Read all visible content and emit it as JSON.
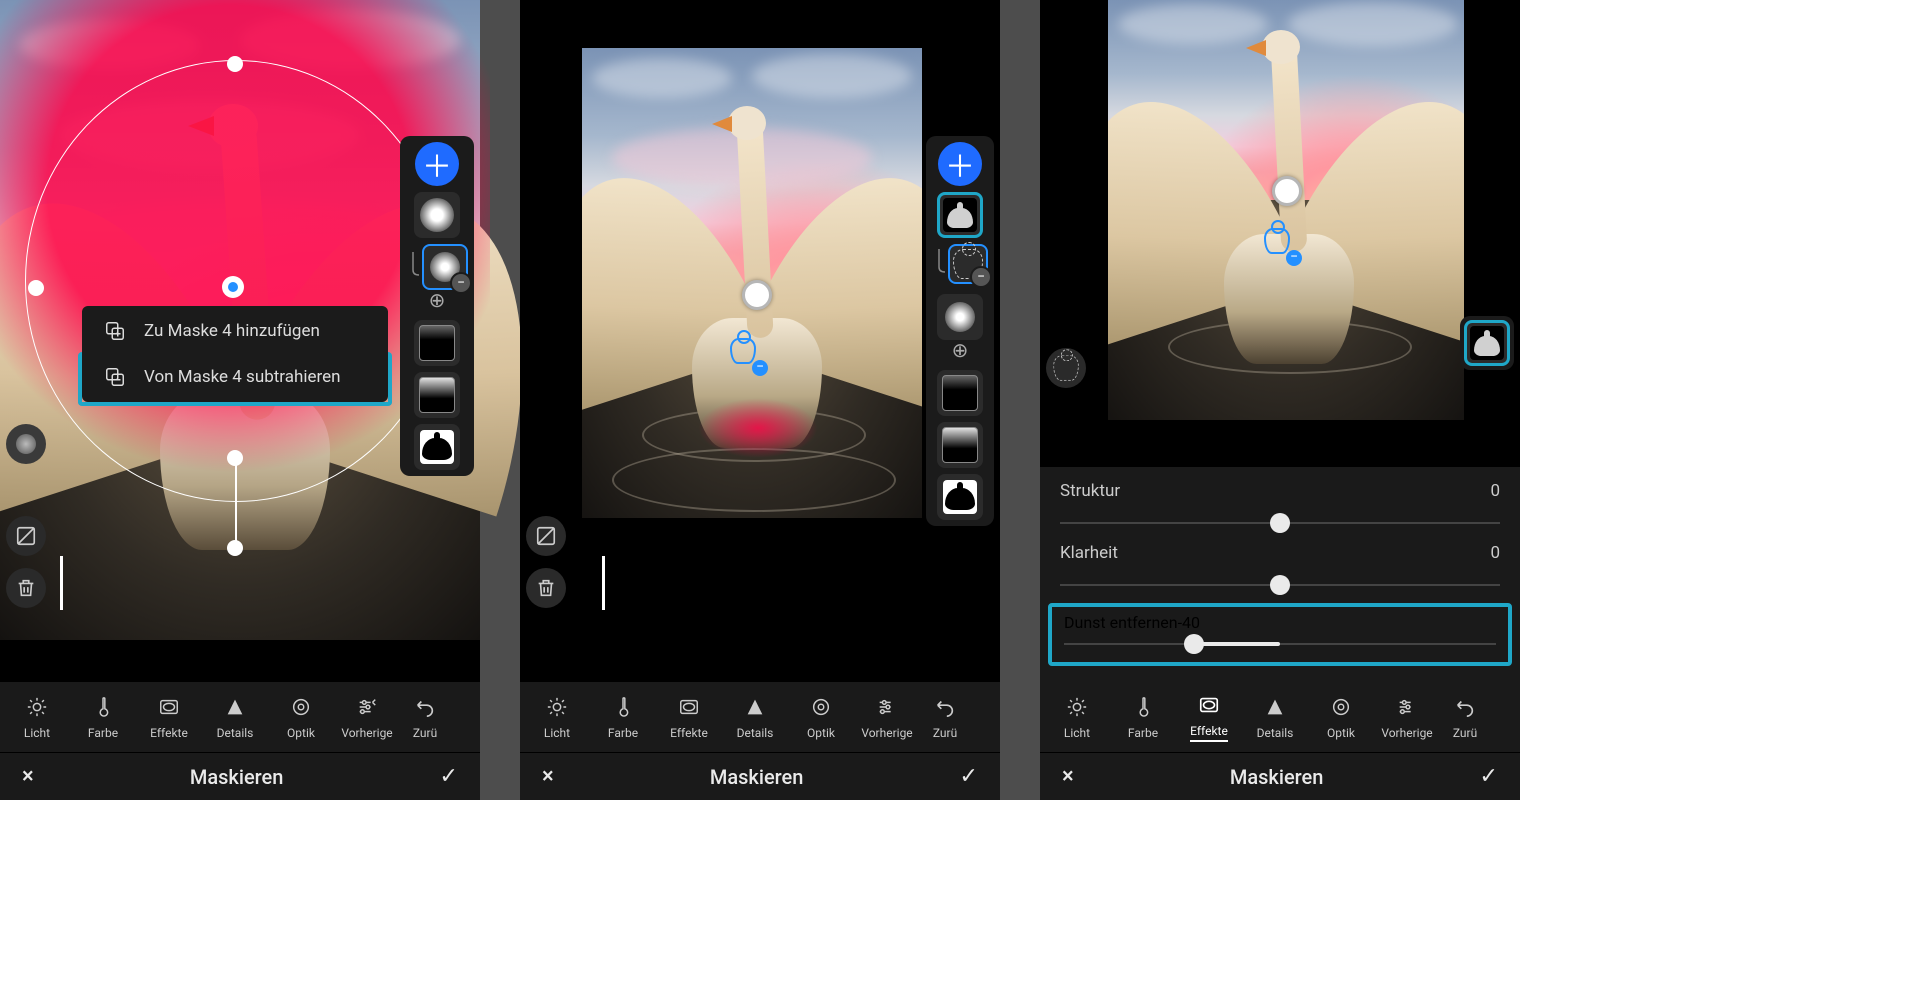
{
  "popup": {
    "add": "Zu Maske 4 hinzufügen",
    "subtract": "Von Maske 4 subtrahieren"
  },
  "toolbar": {
    "licht": "Licht",
    "farbe": "Farbe",
    "effekte": "Effekte",
    "details": "Details",
    "optik": "Optik",
    "vorherige": "Vorherige",
    "zurue": "Zurü"
  },
  "bottom": {
    "title": "Maskieren",
    "close": "×",
    "confirm": "✓"
  },
  "sliders": {
    "struktur": {
      "label": "Struktur",
      "value": "0"
    },
    "klarheit": {
      "label": "Klarheit",
      "value": "0"
    },
    "dunst": {
      "label": "Dunst entfernen",
      "value": "-40"
    }
  },
  "icons": {
    "add": "＋",
    "minus": "−",
    "close": "×",
    "check": "✓"
  }
}
